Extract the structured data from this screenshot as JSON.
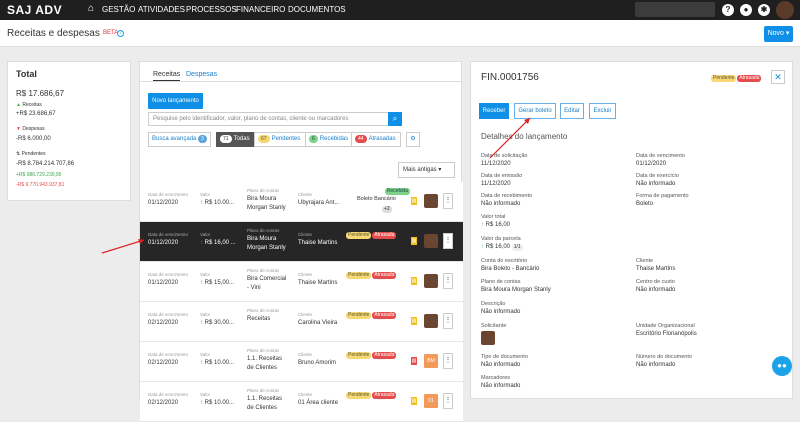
{
  "app": {
    "logo": "SAJ ADV",
    "home_icon": "home-icon",
    "nav": [
      "GESTÃO",
      "ATIVIDADES",
      "PROCESSOS",
      "FINANCEIRO",
      "DOCUMENTOS"
    ]
  },
  "header": {
    "title": "Receitas e despesas",
    "beta": "BETA",
    "new_button": "Novo ▾"
  },
  "summary": {
    "title": "Total",
    "total": "R$ 17.686,67",
    "receitas_label": "Receitas",
    "receitas_value": "+R$ 23.686,67",
    "despesas_label": "Despesas",
    "despesas_value": "-R$ 6.000,00",
    "pendentes_label": "Pendentes",
    "pendentes_value": "-R$ 8.784.214.707,86",
    "pendentes_pos": "+R$ 986.729.230,95",
    "pendentes_neg": "-R$ 9.770.943.937,81"
  },
  "tabs": [
    "Receitas",
    "Despesas"
  ],
  "new_entry": "Novo lançamento",
  "search": {
    "placeholder": "Pesquise pelo identificador, valor, plano de contas, cliente ou marcadores"
  },
  "filters": {
    "advanced": "Busca avançada",
    "advanced_count": "3",
    "todas_count": "71",
    "todas": "Todas",
    "pend_count": "67",
    "pend": "Pendentes",
    "rec_count": "6",
    "rec": "Recebidas",
    "atr_count": "44",
    "atr": "Atrasadas"
  },
  "sort": "Mais antigas ▾",
  "col_labels": {
    "venc": "Data de vencimento",
    "valor": "Valor",
    "plano": "Plano de contas",
    "cliente": "Cliente"
  },
  "rows": [
    {
      "date": "01/12/2020",
      "value": "R$ 10.00...",
      "plano1": "Bira Moura",
      "plano2": "Morgan Stanly",
      "cliente": "Ubyrajara Ant...",
      "b1": "Recebida",
      "b2": "Boleto Bancário",
      "b3": "+2"
    },
    {
      "date": "01/12/2020",
      "value": "R$ 16,00 ...",
      "plano1": "Bira Moura",
      "plano2": "Morgan Stanly",
      "cliente": "Thaise Martins",
      "b1": "Pendente",
      "b2": "Atrasada"
    },
    {
      "date": "01/12/2020",
      "value": "R$ 15,00...",
      "plano1": "Bira Comercial",
      "plano2": "- Vini",
      "cliente": "Thaise Martins",
      "b1": "Pendente",
      "b2": "Atrasada"
    },
    {
      "date": "02/12/2020",
      "value": "R$ 30,00...",
      "plano1": "Receitas",
      "plano2": "",
      "cliente": "Carolina Vieira",
      "b1": "Pendente",
      "b2": "Atrasada"
    },
    {
      "date": "02/12/2020",
      "value": "R$ 10.00...",
      "plano1": "1.1. Receitas",
      "plano2": "de Clientes",
      "cliente": "Bruno Amorim",
      "b1": "Pendente",
      "b2": "Atrasada",
      "tag": "BM"
    },
    {
      "date": "02/12/2020",
      "value": "R$ 10.00...",
      "plano1": "1.1. Receitas",
      "plano2": "de Clientes",
      "cliente": "01 Área cliente",
      "b1": "Pendente",
      "b2": "Atrasada",
      "tag": "01"
    }
  ],
  "detail": {
    "id": "FIN.0001756",
    "b1": "Pendente",
    "b2": "Atrasada",
    "actions": [
      "Receber",
      "Gerar boleto",
      "Editar",
      "Excluir"
    ],
    "section": "Detalhes do lançamento",
    "fields": [
      {
        "l": "Data de solicitação",
        "v": "11/12/2020"
      },
      {
        "l": "Data de vencimento",
        "v": "01/12/2020"
      },
      {
        "l": "Data de emissão",
        "v": "11/12/2020"
      },
      {
        "l": "Data de exercício",
        "v": "Não informado"
      },
      {
        "l": "Data de recebimento",
        "v": "Não informado"
      },
      {
        "l": "Forma de pagamento",
        "v": "Boleto"
      },
      {
        "l": "Valor total",
        "v": "R$ 16,00"
      },
      {
        "l": "Valor da parcela",
        "v": "R$ 16,00",
        "extra": "1/1"
      },
      {
        "l": "Conta do escritório",
        "v": "Bira Boleto - Bancário"
      },
      {
        "l": "Cliente",
        "v": "Thaise Martins"
      },
      {
        "l": "Plano de contas",
        "v": "Bira Moura Morgan Stanly"
      },
      {
        "l": "Centro de custo",
        "v": "Não informado"
      },
      {
        "l": "Descrição",
        "v": "Não informado"
      },
      {
        "l": "Solicitante",
        "v": ""
      },
      {
        "l": "Unidade Organizacional",
        "v": "Escritório Florianópolis"
      },
      {
        "l": "Tipo de documento",
        "v": "Não informado"
      },
      {
        "l": "Número do documento",
        "v": "Não informado"
      },
      {
        "l": "Marcadores",
        "v": "Não informado"
      }
    ]
  }
}
